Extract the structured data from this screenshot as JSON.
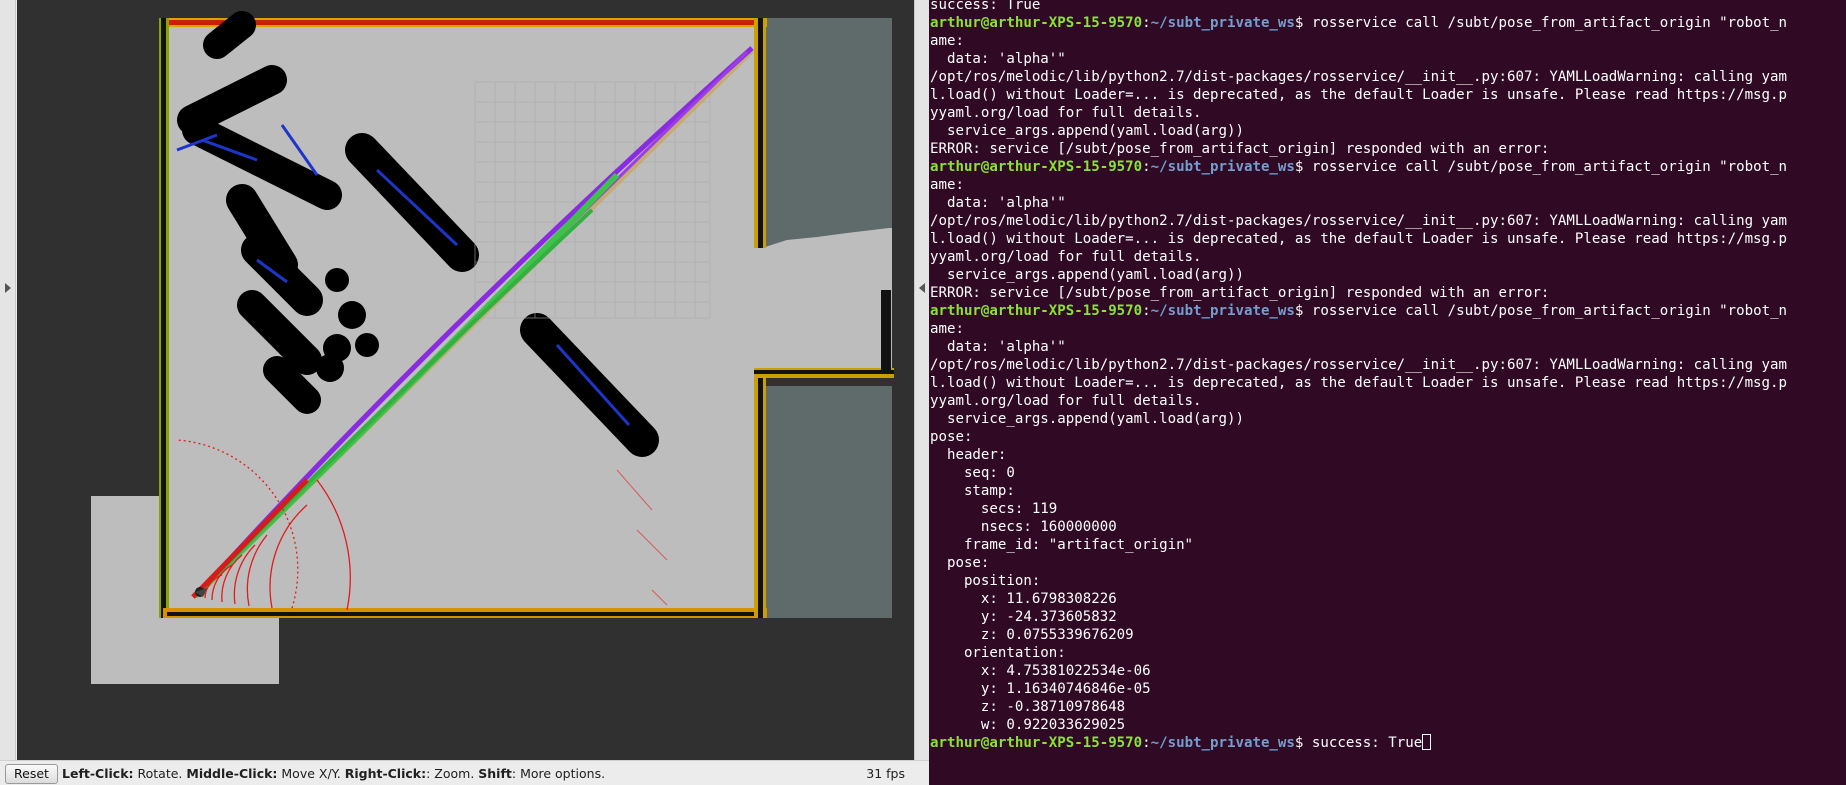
{
  "rviz": {
    "reset_label": "Reset",
    "hint": {
      "k1": "Left-Click:",
      "v1": " Rotate. ",
      "k2": "Middle-Click:",
      "v2": " Move X/Y. ",
      "k3": "Right-Click:",
      "v3": ": Zoom. ",
      "k4": "Shift",
      "v4": ": More options."
    },
    "fps": "31 fps",
    "colors": {
      "background": "#303030",
      "map_free": "#bdbdbd",
      "map_unknown": "#5f6b6b",
      "obstacle": "#000000",
      "path_green": "#3ec24a",
      "path_purple": "#8a2be2",
      "laser": "#e21b1b"
    }
  },
  "terminal": {
    "colors": {
      "background": "#300a24",
      "user": "#8ae234",
      "path": "#729fcf",
      "text": "#ffffff"
    },
    "prompt": {
      "user": "arthur@arthur-XPS-15-9570",
      "sep": ":",
      "path": "~/subt_private_ws",
      "symbol": "$"
    },
    "lines": [
      "success: True",
      "rosservice call /subt/pose_from_artifact_origin \"robot_n",
      "ame:",
      "  data: 'alpha'\"",
      "/opt/ros/melodic/lib/python2.7/dist-packages/rosservice/__init__.py:607: YAMLLoadWarning: calling yam",
      "l.load() without Loader=... is deprecated, as the default Loader is unsafe. Please read https://msg.p",
      "yyaml.org/load for full details.",
      "  service_args.append(yaml.load(arg))",
      "ERROR: service [/subt/pose_from_artifact_origin] responded with an error:",
      "rosservice call /subt/pose_from_artifact_origin \"robot_n",
      "ame:",
      "  data: 'alpha'\"",
      "/opt/ros/melodic/lib/python2.7/dist-packages/rosservice/__init__.py:607: YAMLLoadWarning: calling yam",
      "l.load() without Loader=... is deprecated, as the default Loader is unsafe. Please read https://msg.p",
      "yyaml.org/load for full details.",
      "  service_args.append(yaml.load(arg))",
      "ERROR: service [/subt/pose_from_artifact_origin] responded with an error:",
      "rosservice call /subt/pose_from_artifact_origin \"robot_n",
      "ame:",
      "  data: 'alpha'\"",
      "/opt/ros/melodic/lib/python2.7/dist-packages/rosservice/__init__.py:607: YAMLLoadWarning: calling yam",
      "l.load() without Loader=... is deprecated, as the default Loader is unsafe. Please read https://msg.p",
      "yyaml.org/load for full details.",
      "  service_args.append(yaml.load(arg))",
      "pose:",
      "  header:",
      "    seq: 0",
      "    stamp:",
      "      secs: 119",
      "      nsecs: 160000000",
      "    frame_id: \"artifact_origin\"",
      "  pose:",
      "    position:",
      "      x: 11.6798308226",
      "      y: -24.373605832",
      "      z: 0.0755339676209",
      "    orientation:",
      "      x: 4.75381022534e-06",
      "      y: 1.16340746846e-05",
      "      z: -0.38710978648",
      "      w: 0.922033629025",
      "success: True",
      ""
    ]
  }
}
